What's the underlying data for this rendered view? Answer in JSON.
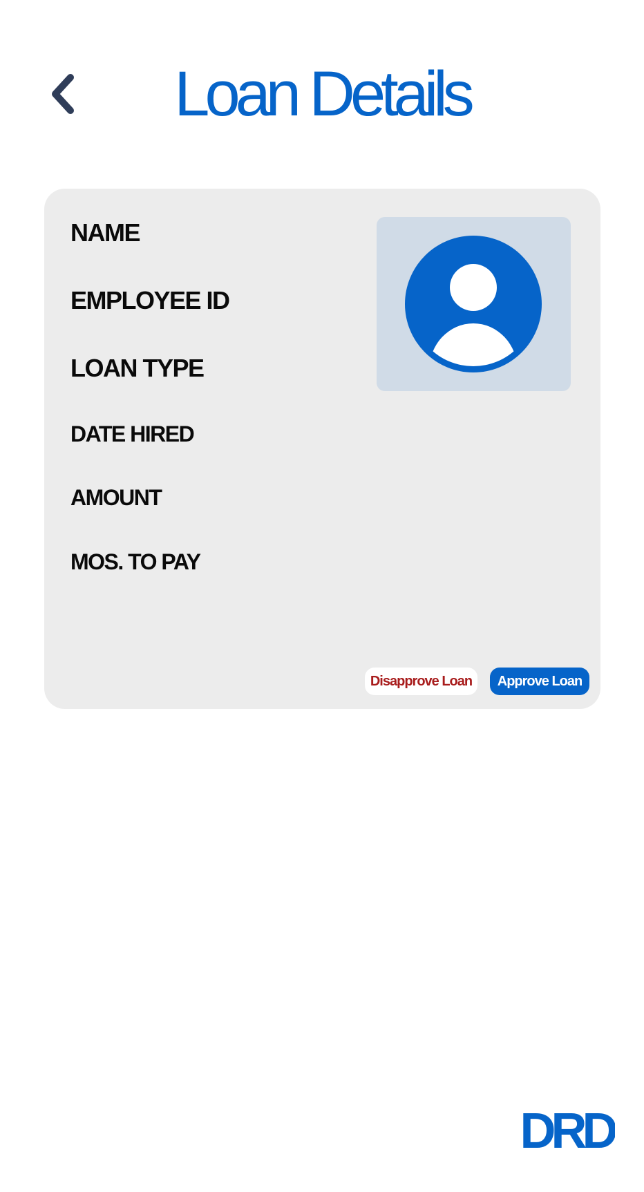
{
  "header": {
    "title": "Loan Details",
    "back_icon": "chevron-left-icon"
  },
  "card": {
    "fields": {
      "name": "NAME",
      "employee_id": "EMPLOYEE ID",
      "loan_type": "LOAN TYPE",
      "date_hired": "DATE HIRED",
      "amount": "AMOUNT",
      "months_to_pay": "MOS. TO PAY"
    },
    "avatar_icon": "user-avatar-icon",
    "buttons": {
      "disapprove": "Disapprove Loan",
      "approve": "Approve Loan"
    }
  },
  "brand": {
    "logo_text": "DRD"
  },
  "colors": {
    "accent": "#0664c9",
    "back_arrow": "#2f3d59",
    "card_bg": "#ececec",
    "photo_bg": "#d0dbe7",
    "danger_text": "#a81c1c"
  }
}
